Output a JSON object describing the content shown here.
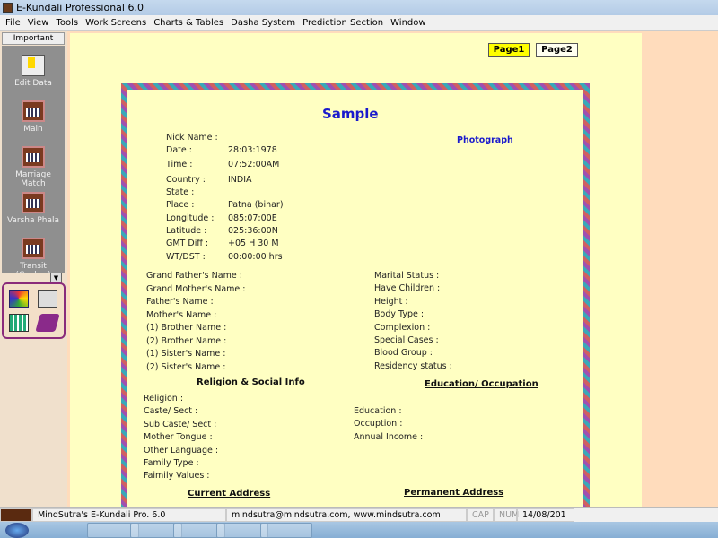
{
  "window": {
    "title": "E-Kundali Professional 6.0"
  },
  "menu": [
    "File",
    "View",
    "Tools",
    "Work Screens",
    "Charts & Tables",
    "Dasha System",
    "Prediction Section",
    "Window"
  ],
  "sidebar": {
    "header": "Important",
    "tools": [
      "Edit Data",
      "Main",
      "Marriage Match",
      "Varsha Phala",
      "Transit (Gochar)"
    ]
  },
  "pages": {
    "page1": "Page1",
    "page2": "Page2",
    "active": "Page1"
  },
  "sheet": {
    "title": "Sample",
    "photo": "Photograph",
    "birth": [
      [
        "Nick Name :",
        ""
      ],
      [
        "Date :",
        "28:03:1978"
      ],
      [
        "Time :",
        "07:52:00AM"
      ],
      [
        "Country :",
        "INDIA"
      ],
      [
        "State :",
        ""
      ],
      [
        "Place :",
        "Patna (bihar)"
      ],
      [
        "Longitude :",
        "085:07:00E"
      ],
      [
        "Latitude :",
        "025:36:00N"
      ],
      [
        "GMT Diff :",
        "+05 H 30 M"
      ],
      [
        "WT/DST :",
        "00:00:00 hrs"
      ]
    ],
    "family": [
      "Grand Father's Name :",
      "Grand Mother's Name :",
      "Father's Name :",
      "Mother's Name :",
      "(1) Brother Name :",
      "(2) Brother Name :",
      "(1) Sister's Name :",
      "(2) Sister's Name :"
    ],
    "personal": [
      "Marital Status :",
      "Have Children :",
      "Height :",
      "Body Type :",
      "Complexion :",
      "Special Cases :",
      "Blood Group :",
      "Residency status :"
    ],
    "religion_heading": "Religion & Social Info",
    "religion": [
      "Religion :",
      "Caste/ Sect :",
      "Sub Caste/ Sect :",
      "Mother Tongue :",
      "Other Language :",
      "Family Type :",
      "Faimily Values :"
    ],
    "education_heading": "Education/ Occupation",
    "education": [
      "Education :",
      "Occuption :",
      "Annual Income :"
    ],
    "current_address": "Current Address",
    "permanent_address": "Permanent Address"
  },
  "status": {
    "app": "MindSutra's E-Kundali Pro. 6.0",
    "contact": "mindsutra@mindsutra.com, www.mindsutra.com",
    "cap": "CAP",
    "num": "NUM",
    "date": "14/08/201"
  },
  "colors": {
    "content_bg": "#ffffc2",
    "title_blue": "#1a1acc",
    "active_page": "#ffff00"
  }
}
